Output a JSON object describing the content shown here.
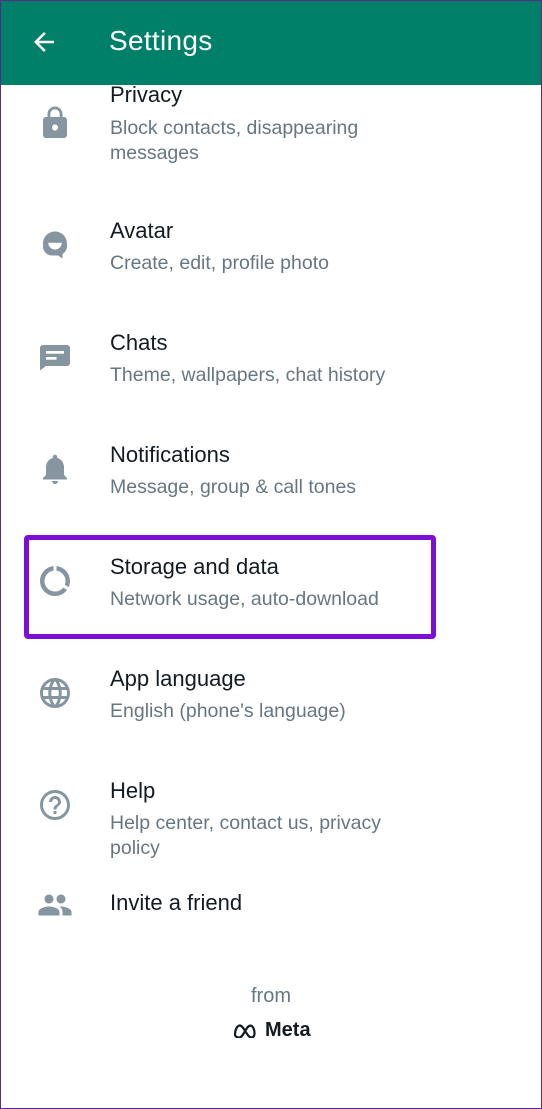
{
  "header": {
    "title": "Settings",
    "back_icon": "arrow-back-icon"
  },
  "items": [
    {
      "label": "Privacy",
      "sub": "Block contacts, disappearing messages",
      "icon": "lock-icon"
    },
    {
      "label": "Avatar",
      "sub": "Create, edit, profile photo",
      "icon": "avatar-icon"
    },
    {
      "label": "Chats",
      "sub": "Theme, wallpapers, chat history",
      "icon": "chat-icon"
    },
    {
      "label": "Notifications",
      "sub": "Message, group & call tones",
      "icon": "bell-icon"
    },
    {
      "label": "Storage and data",
      "sub": "Network usage, auto-download",
      "icon": "storage-circle-icon"
    },
    {
      "label": "App language",
      "sub": "English (phone's language)",
      "icon": "globe-icon"
    },
    {
      "label": "Help",
      "sub": "Help center, contact us, privacy policy",
      "icon": "help-icon"
    },
    {
      "label": "Invite a friend",
      "sub": "",
      "icon": "people-icon"
    }
  ],
  "footer": {
    "from": "from",
    "brand": "Meta"
  },
  "colors": {
    "appbar": "#008069",
    "highlight": "#7b0fd6",
    "icon": "#8696a0"
  }
}
